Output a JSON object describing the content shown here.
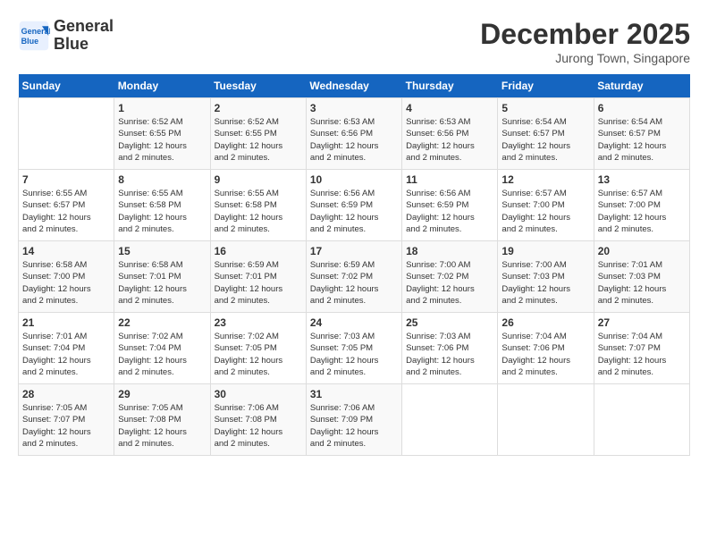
{
  "logo": {
    "line1": "General",
    "line2": "Blue"
  },
  "title": "December 2025",
  "subtitle": "Jurong Town, Singapore",
  "days_header": [
    "Sunday",
    "Monday",
    "Tuesday",
    "Wednesday",
    "Thursday",
    "Friday",
    "Saturday"
  ],
  "weeks": [
    [
      {
        "day": "",
        "info": ""
      },
      {
        "day": "1",
        "info": "Sunrise: 6:52 AM\nSunset: 6:55 PM\nDaylight: 12 hours\nand 2 minutes."
      },
      {
        "day": "2",
        "info": "Sunrise: 6:52 AM\nSunset: 6:55 PM\nDaylight: 12 hours\nand 2 minutes."
      },
      {
        "day": "3",
        "info": "Sunrise: 6:53 AM\nSunset: 6:56 PM\nDaylight: 12 hours\nand 2 minutes."
      },
      {
        "day": "4",
        "info": "Sunrise: 6:53 AM\nSunset: 6:56 PM\nDaylight: 12 hours\nand 2 minutes."
      },
      {
        "day": "5",
        "info": "Sunrise: 6:54 AM\nSunset: 6:57 PM\nDaylight: 12 hours\nand 2 minutes."
      },
      {
        "day": "6",
        "info": "Sunrise: 6:54 AM\nSunset: 6:57 PM\nDaylight: 12 hours\nand 2 minutes."
      }
    ],
    [
      {
        "day": "7",
        "info": "Sunrise: 6:55 AM\nSunset: 6:57 PM\nDaylight: 12 hours\nand 2 minutes."
      },
      {
        "day": "8",
        "info": "Sunrise: 6:55 AM\nSunset: 6:58 PM\nDaylight: 12 hours\nand 2 minutes."
      },
      {
        "day": "9",
        "info": "Sunrise: 6:55 AM\nSunset: 6:58 PM\nDaylight: 12 hours\nand 2 minutes."
      },
      {
        "day": "10",
        "info": "Sunrise: 6:56 AM\nSunset: 6:59 PM\nDaylight: 12 hours\nand 2 minutes."
      },
      {
        "day": "11",
        "info": "Sunrise: 6:56 AM\nSunset: 6:59 PM\nDaylight: 12 hours\nand 2 minutes."
      },
      {
        "day": "12",
        "info": "Sunrise: 6:57 AM\nSunset: 7:00 PM\nDaylight: 12 hours\nand 2 minutes."
      },
      {
        "day": "13",
        "info": "Sunrise: 6:57 AM\nSunset: 7:00 PM\nDaylight: 12 hours\nand 2 minutes."
      }
    ],
    [
      {
        "day": "14",
        "info": "Sunrise: 6:58 AM\nSunset: 7:00 PM\nDaylight: 12 hours\nand 2 minutes."
      },
      {
        "day": "15",
        "info": "Sunrise: 6:58 AM\nSunset: 7:01 PM\nDaylight: 12 hours\nand 2 minutes."
      },
      {
        "day": "16",
        "info": "Sunrise: 6:59 AM\nSunset: 7:01 PM\nDaylight: 12 hours\nand 2 minutes."
      },
      {
        "day": "17",
        "info": "Sunrise: 6:59 AM\nSunset: 7:02 PM\nDaylight: 12 hours\nand 2 minutes."
      },
      {
        "day": "18",
        "info": "Sunrise: 7:00 AM\nSunset: 7:02 PM\nDaylight: 12 hours\nand 2 minutes."
      },
      {
        "day": "19",
        "info": "Sunrise: 7:00 AM\nSunset: 7:03 PM\nDaylight: 12 hours\nand 2 minutes."
      },
      {
        "day": "20",
        "info": "Sunrise: 7:01 AM\nSunset: 7:03 PM\nDaylight: 12 hours\nand 2 minutes."
      }
    ],
    [
      {
        "day": "21",
        "info": "Sunrise: 7:01 AM\nSunset: 7:04 PM\nDaylight: 12 hours\nand 2 minutes."
      },
      {
        "day": "22",
        "info": "Sunrise: 7:02 AM\nSunset: 7:04 PM\nDaylight: 12 hours\nand 2 minutes."
      },
      {
        "day": "23",
        "info": "Sunrise: 7:02 AM\nSunset: 7:05 PM\nDaylight: 12 hours\nand 2 minutes."
      },
      {
        "day": "24",
        "info": "Sunrise: 7:03 AM\nSunset: 7:05 PM\nDaylight: 12 hours\nand 2 minutes."
      },
      {
        "day": "25",
        "info": "Sunrise: 7:03 AM\nSunset: 7:06 PM\nDaylight: 12 hours\nand 2 minutes."
      },
      {
        "day": "26",
        "info": "Sunrise: 7:04 AM\nSunset: 7:06 PM\nDaylight: 12 hours\nand 2 minutes."
      },
      {
        "day": "27",
        "info": "Sunrise: 7:04 AM\nSunset: 7:07 PM\nDaylight: 12 hours\nand 2 minutes."
      }
    ],
    [
      {
        "day": "28",
        "info": "Sunrise: 7:05 AM\nSunset: 7:07 PM\nDaylight: 12 hours\nand 2 minutes."
      },
      {
        "day": "29",
        "info": "Sunrise: 7:05 AM\nSunset: 7:08 PM\nDaylight: 12 hours\nand 2 minutes."
      },
      {
        "day": "30",
        "info": "Sunrise: 7:06 AM\nSunset: 7:08 PM\nDaylight: 12 hours\nand 2 minutes."
      },
      {
        "day": "31",
        "info": "Sunrise: 7:06 AM\nSunset: 7:09 PM\nDaylight: 12 hours\nand 2 minutes."
      },
      {
        "day": "",
        "info": ""
      },
      {
        "day": "",
        "info": ""
      },
      {
        "day": "",
        "info": ""
      }
    ]
  ]
}
